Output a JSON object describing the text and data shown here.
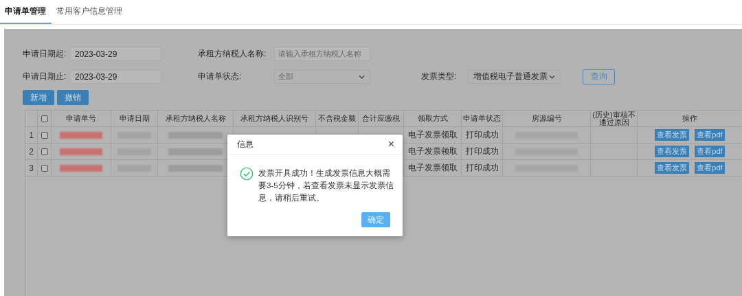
{
  "tabs": [
    {
      "label": "申请单管理",
      "selected": true
    },
    {
      "label": "常用客户信息管理",
      "selected": false
    }
  ],
  "filters": {
    "row_1": [
      {
        "label": "申请日期起:",
        "kind": "input",
        "value": "2023-03-29"
      },
      {
        "label": "承租方纳税人名称:",
        "kind": "input",
        "placeholder": "请输入承租方纳税人名称"
      }
    ],
    "row_2": [
      {
        "label": "申请日期止:",
        "kind": "input",
        "value": "2023-03-29"
      },
      {
        "label": "申请单状态:",
        "kind": "select",
        "placeholder": "全部"
      },
      {
        "label": "发票类型:",
        "kind": "select",
        "value": "增值税电子普通发票"
      }
    ],
    "query_button": "查询"
  },
  "actions": [
    "新增",
    "撤销"
  ],
  "table": {
    "all_checked": false,
    "columns": [
      "申请单号",
      "申请日期",
      "承租方纳税人名称",
      "承租方纳税人识别号",
      "不含税金额",
      "合计应缴税",
      "领取方式",
      "申请单状态",
      "房源编号",
      "(历史)审核不通过原因",
      "操作"
    ],
    "rows": [
      {
        "index": "1",
        "checked": false,
        "cells": [
          {
            "kind": "redacted",
            "color": "#c97070"
          },
          {
            "kind": "redacted",
            "color": "#a4a4a4"
          },
          {
            "kind": "redacted",
            "color": "#9c9c9c"
          },
          {
            "kind": "blank"
          },
          {
            "kind": "blank"
          },
          {
            "kind": "blank"
          },
          {
            "kind": "text",
            "text": "电子发票领取"
          },
          {
            "kind": "text",
            "text": "打印成功"
          },
          {
            "kind": "redacted",
            "color": "#a6a6a6"
          },
          {
            "kind": "blank"
          }
        ],
        "actions": [
          "查看发票",
          "查看pdf"
        ]
      },
      {
        "index": "2",
        "checked": false,
        "cells": [
          {
            "kind": "redacted",
            "color": "#c97070"
          },
          {
            "kind": "redacted",
            "color": "#a4a4a4"
          },
          {
            "kind": "redacted",
            "color": "#9c9c9c"
          },
          {
            "kind": "blank"
          },
          {
            "kind": "blank"
          },
          {
            "kind": "blank"
          },
          {
            "kind": "text",
            "text": "电子发票领取"
          },
          {
            "kind": "text",
            "text": "打印成功"
          },
          {
            "kind": "redacted",
            "color": "#a6a6a6"
          },
          {
            "kind": "blank"
          }
        ],
        "actions": [
          "查看发票",
          "查看pdf"
        ]
      },
      {
        "index": "3",
        "checked": false,
        "cells": [
          {
            "kind": "redacted",
            "color": "#c97070"
          },
          {
            "kind": "redacted",
            "color": "#a4a4a4"
          },
          {
            "kind": "redacted",
            "color": "#9c9c9c"
          },
          {
            "kind": "blank"
          },
          {
            "kind": "blank"
          },
          {
            "kind": "blank"
          },
          {
            "kind": "text",
            "text": "电子发票领取"
          },
          {
            "kind": "text",
            "text": "打印成功"
          },
          {
            "kind": "redacted",
            "color": "#a6a6a6"
          },
          {
            "kind": "blank"
          }
        ],
        "actions": [
          "查看发票",
          "查看pdf"
        ]
      }
    ]
  },
  "dialog": {
    "title": "信息",
    "close": "×",
    "message": "发票开具成功！生成发票信息大概需要3-5分钟，若查看发票未显示发票信息，请稍后重试。",
    "confirm": "确定"
  }
}
